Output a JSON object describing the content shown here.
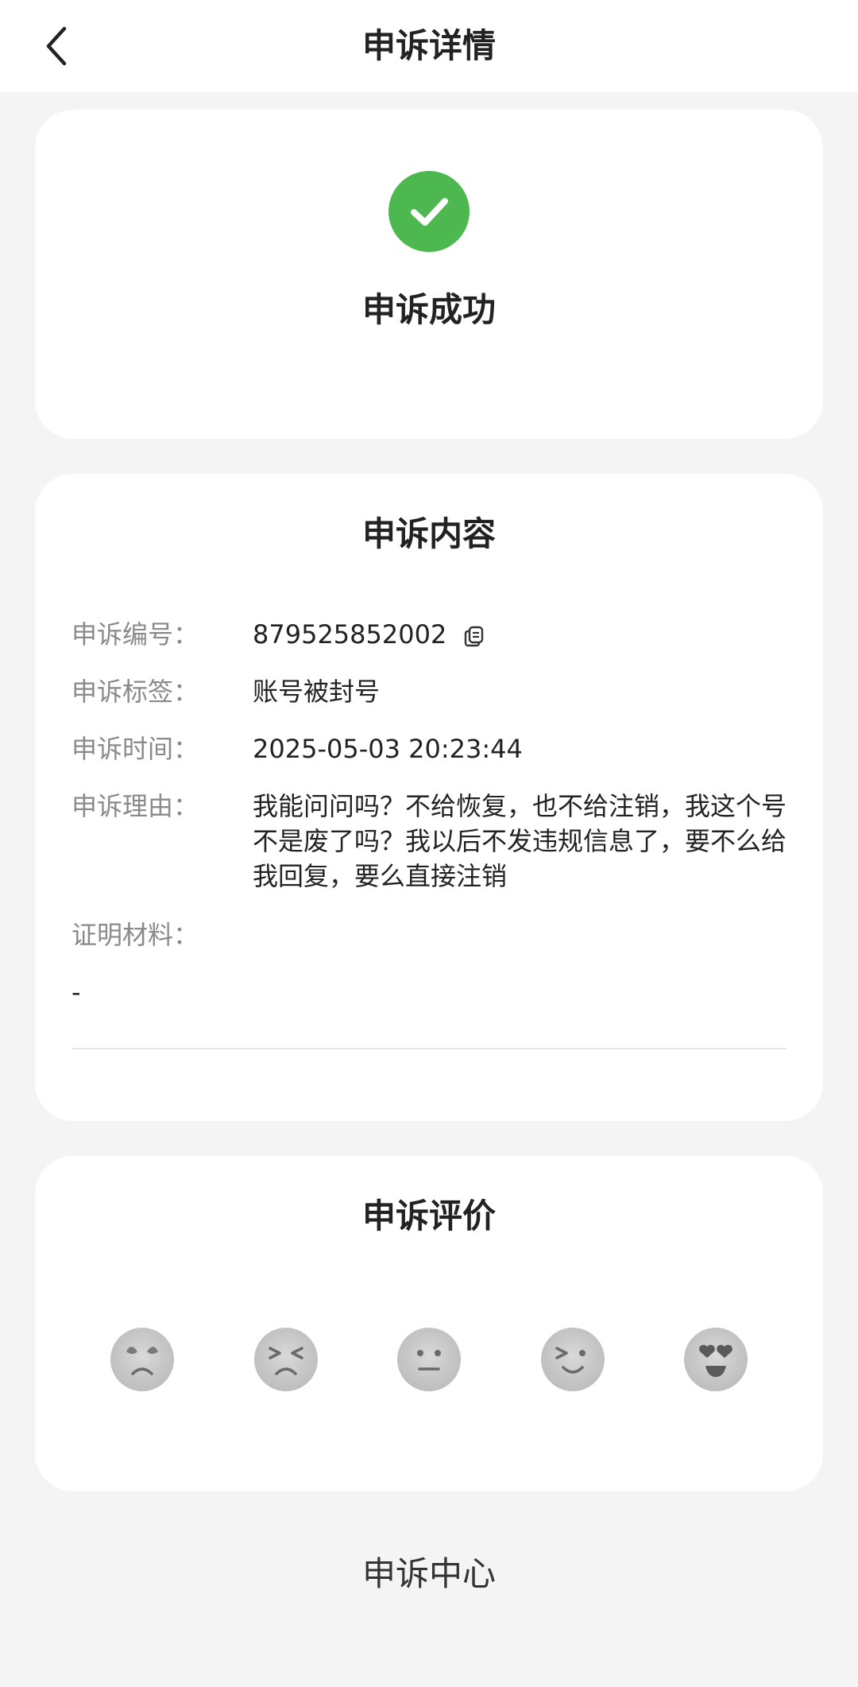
{
  "header": {
    "title": "申诉详情"
  },
  "status": {
    "text": "申诉成功",
    "color": "#4cb84f"
  },
  "content": {
    "title": "申诉内容",
    "fields": [
      {
        "label": "申诉编号：",
        "value": "879525852002"
      },
      {
        "label": "申诉标签：",
        "value": "账号被封号"
      },
      {
        "label": "申诉时间：",
        "value": "2025-05-03 20:23:44"
      },
      {
        "label": "申诉理由：",
        "value": "我能问问吗？不给恢复，也不给注销，我这个号不是废了吗？我以后不发违规信息了，要不么给我回复，要么直接注销"
      },
      {
        "label": "证明材料：",
        "value": ""
      }
    ],
    "evidence_placeholder": "-"
  },
  "rating": {
    "title": "申诉评价",
    "faces": [
      "angry-face-icon",
      "sad-face-icon",
      "neutral-face-icon",
      "happy-face-icon",
      "love-face-icon"
    ]
  },
  "footer": {
    "link": "申诉中心"
  }
}
